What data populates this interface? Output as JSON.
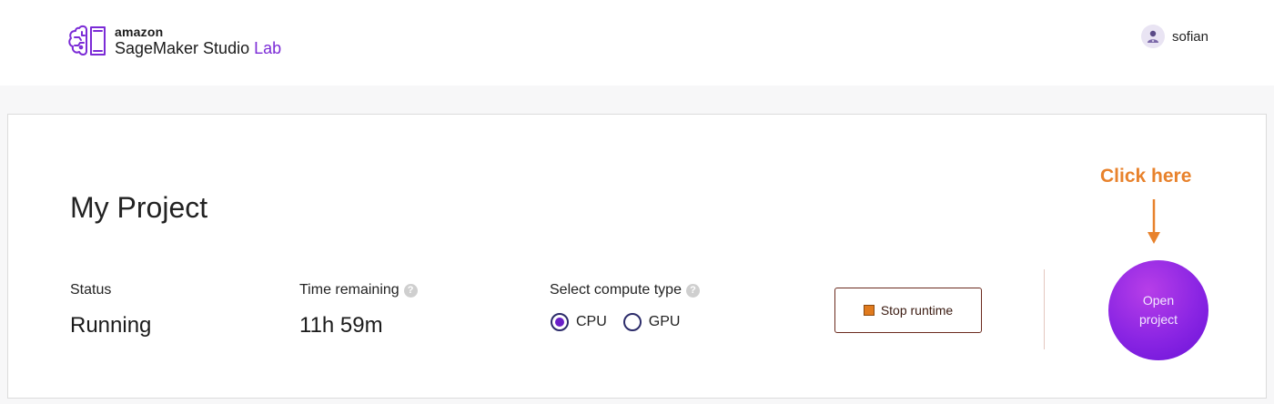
{
  "header": {
    "brand_small": "amazon",
    "brand_main": "SageMaker Studio",
    "brand_accent": "Lab",
    "user_name": "sofian"
  },
  "project": {
    "title": "My Project",
    "status_label": "Status",
    "status_value": "Running",
    "time_label": "Time remaining",
    "time_value": "11h 59m",
    "compute_label": "Select compute type",
    "compute_options": [
      {
        "label": "CPU",
        "selected": true
      },
      {
        "label": "GPU",
        "selected": false
      }
    ],
    "stop_button_label": "Stop runtime",
    "open_button_label": "Open project"
  },
  "annotation": {
    "text": "Click here"
  },
  "colors": {
    "accent": "#7b2bd6",
    "annotation": "#e8822c",
    "stop_icon": "#e07a1d"
  }
}
